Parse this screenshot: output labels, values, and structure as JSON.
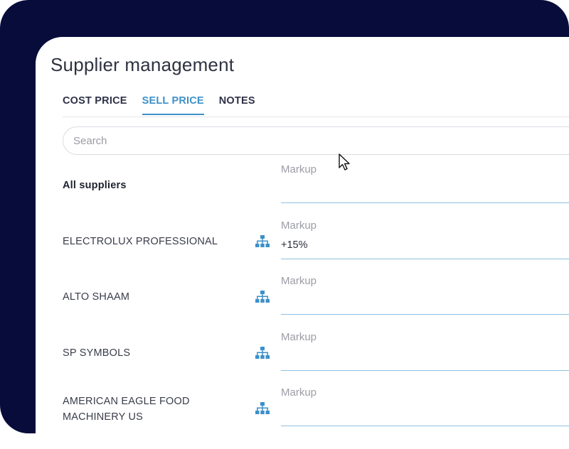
{
  "page": {
    "title": "Supplier management"
  },
  "tabs": [
    {
      "label": "COST PRICE",
      "active": false
    },
    {
      "label": "SELL PRICE",
      "active": true
    },
    {
      "label": "NOTES",
      "active": false
    }
  ],
  "search": {
    "placeholder": "Search",
    "value": ""
  },
  "suppliers": [
    {
      "name": "All suppliers",
      "markup_label": "Markup",
      "markup_value": ""
    },
    {
      "name": "ELECTROLUX PROFESSIONAL",
      "markup_label": "Markup",
      "markup_value": "+15%",
      "icon": "hierarchy-icon"
    },
    {
      "name": "ALTO SHAAM",
      "markup_label": "Markup",
      "markup_value": "",
      "icon": "hierarchy-icon"
    },
    {
      "name": "SP SYMBOLS",
      "markup_label": "Markup",
      "markup_value": "",
      "icon": "hierarchy-icon"
    },
    {
      "name": "AMERICAN EAGLE FOOD MACHINERY US",
      "markup_label": "Markup",
      "markup_value": "",
      "icon": "hierarchy-icon"
    }
  ],
  "colors": {
    "frame": "#070c3b",
    "accent": "#3d90c8",
    "underline": "#8fbfe2"
  }
}
